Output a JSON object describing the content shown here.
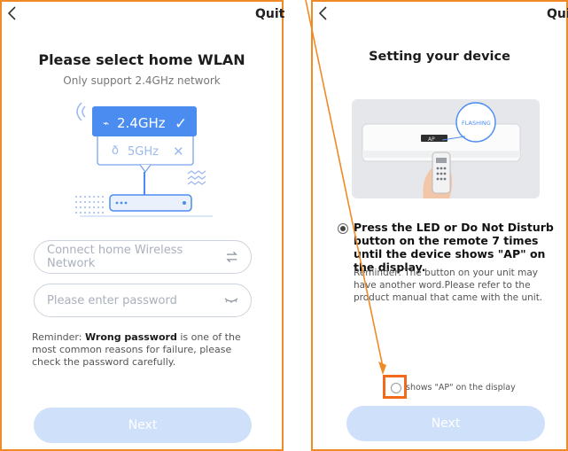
{
  "left_screen": {
    "back_glyph": "<",
    "quit_label": "Quit",
    "title": "Please select home WLAN",
    "subtitle": "Only support 2.4GHz network",
    "illustration": {
      "band_24": "2.4GHz",
      "band_5": "5GHz"
    },
    "network_field": {
      "placeholder": "Connect home Wireless Network",
      "value": ""
    },
    "password_field": {
      "placeholder": "Please enter password",
      "value": ""
    },
    "reminder": {
      "prefix": "Reminder: ",
      "emphasis": "Wrong password",
      "suffix": " is one of the most common reasons for failure, please check the password carefully."
    },
    "next_label": "Next"
  },
  "right_screen": {
    "back_glyph": "<",
    "quit_label": "Quit",
    "title": "Setting your device",
    "illustration": {
      "flash_label": "FLASHING"
    },
    "instruction": "Press the LED or Do Not Disturb button on the remote 7 times until the device shows \"AP\" on the display.",
    "reminder": "Reminder: The button on your unit may have another word.Please refer to the product manual that came with the unit.",
    "confirm_label": "shows \"AP\" on the display",
    "next_label": "Next"
  },
  "colors": {
    "annotation_orange": "#f08a24",
    "accent_blue": "#4a8cf0",
    "button_disabled": "#cfe0fb",
    "highlight": "#f26a1b"
  }
}
